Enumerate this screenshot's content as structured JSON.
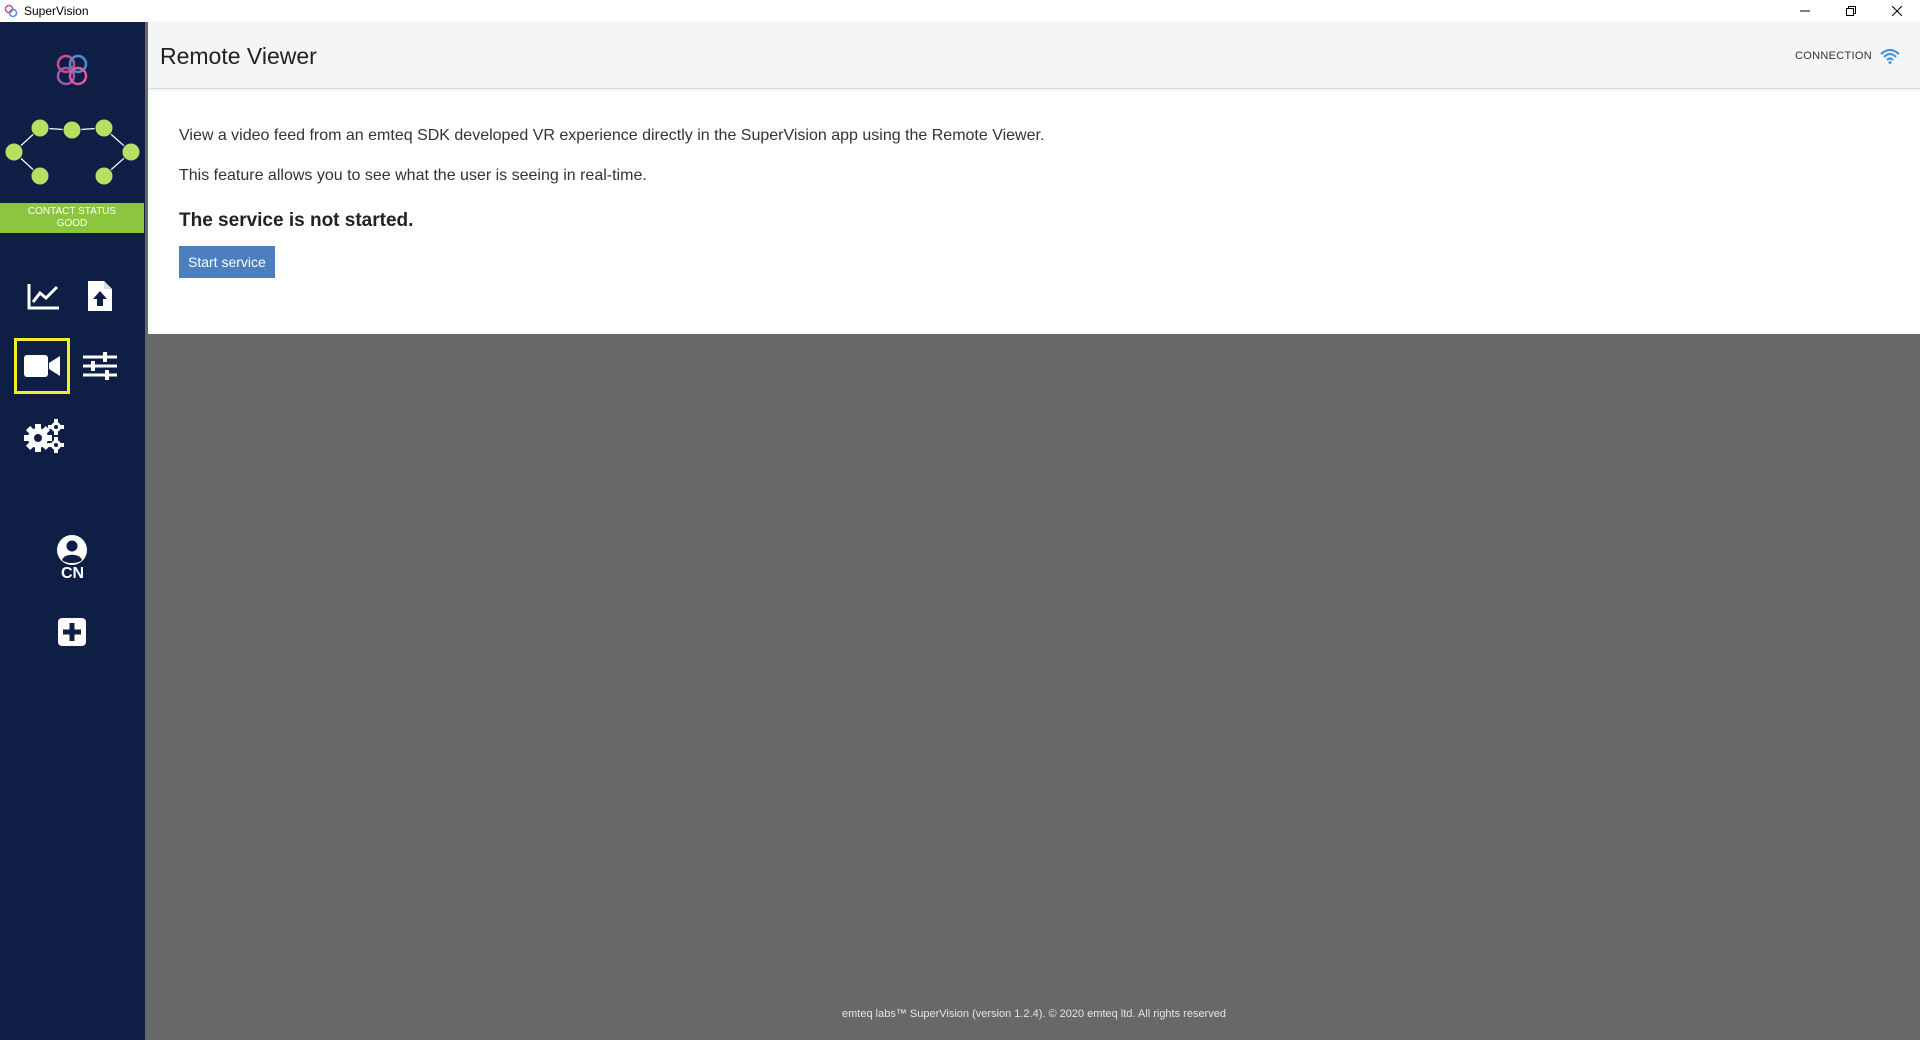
{
  "window": {
    "title": "SuperVision",
    "controls": [
      "minimize-icon",
      "restore-icon",
      "close-icon"
    ]
  },
  "sidebar": {
    "logo": "emteq-logo-icon",
    "contact_status_line1": "CONTACT STATUS",
    "contact_status_line2": "GOOD",
    "nav_icons": [
      "chart-icon",
      "file-upload-icon",
      "video-camera-icon",
      "sliders-icon",
      "gears-icon"
    ],
    "active_item": "video-camera-icon",
    "user_initials": "CN",
    "add_icon": "plus-square-icon"
  },
  "header": {
    "title": "Remote Viewer",
    "connection_label": "CONNECTION",
    "connection_icon": "wifi-icon"
  },
  "content": {
    "description_1": "View a video feed from an emteq SDK developed VR experience directly in the SuperVision app using the Remote Viewer.",
    "description_2": "This feature allows you to see what the user is seeing in real-time.",
    "service_status": "The service is not started.",
    "start_button": "Start service"
  },
  "footer": {
    "text": "emteq labs™ SuperVision (version 1.2.4). © 2020 emteq ltd. All rights reserved"
  },
  "colors": {
    "sidebar_bg": "#0e1e45",
    "contact_good": "#8cc63f",
    "active_highlight": "#f2ef2a",
    "button_blue": "#4d7fbe",
    "backdrop": "#686868"
  }
}
